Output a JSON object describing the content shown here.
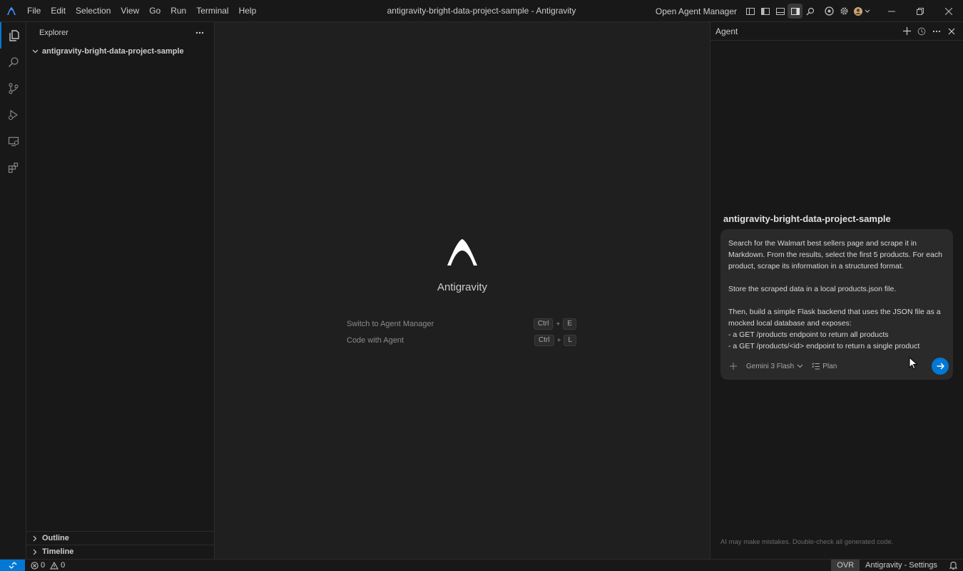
{
  "window": {
    "title": "antigravity-bright-data-project-sample - Antigravity",
    "open_agent_manager": "Open Agent Manager"
  },
  "menu": [
    "File",
    "Edit",
    "Selection",
    "View",
    "Go",
    "Run",
    "Terminal",
    "Help"
  ],
  "activity_icons": [
    "files-icon",
    "search-icon",
    "source-control-icon",
    "run-debug-icon",
    "remote-explorer-icon",
    "extensions-icon"
  ],
  "sidebar": {
    "title": "Explorer",
    "folder": "antigravity-bright-data-project-sample",
    "sections": [
      "Outline",
      "Timeline"
    ]
  },
  "editor": {
    "app_name": "Antigravity",
    "shortcuts": [
      {
        "label": "Switch to Agent Manager",
        "keys": [
          "Ctrl",
          "E"
        ]
      },
      {
        "label": "Code with Agent",
        "keys": [
          "Ctrl",
          "L"
        ]
      }
    ]
  },
  "agent": {
    "title": "Agent",
    "project": "antigravity-bright-data-project-sample",
    "prompt": "Search for the Walmart best sellers page and scrape it in Markdown. From the results, select the first 5 products. For each product, scrape its information in a structured format.\n\nStore the scraped data in a local products.json file.\n\nThen, build a simple Flask backend that uses the JSON file as a mocked local database and exposes:\n- a GET /products endpoint to return all products\n- a GET /products/<id> endpoint to return a single product",
    "model": "Gemini 3 Flash",
    "mode": "Plan",
    "disclaimer": "AI may make mistakes. Double-check all generated code."
  },
  "status": {
    "errors": "0",
    "warnings": "0",
    "ovr": "OVR",
    "settings": "Antigravity - Settings"
  },
  "colors": {
    "accent": "#0078d4",
    "background": "#1f1f1f",
    "panel": "#181818"
  }
}
